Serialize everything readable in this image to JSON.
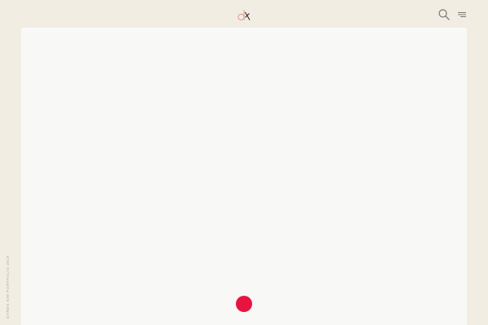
{
  "brand": {
    "logo_icon": "dk-monogram-icon",
    "logo_colors": {
      "d": "#d9a092",
      "k": "#2b2b2b"
    }
  },
  "header": {
    "search_icon": "search-icon",
    "menu_icon": "hamburger-menu-icon"
  },
  "sidebar": {
    "caption": "DAREN KIM PORTFOLIO 2019"
  },
  "loader": {
    "color": "#e8143f"
  },
  "colors": {
    "background": "#f2ede3",
    "stage": "#f8f8f7",
    "accent": "#e8143f",
    "icon": "#777777"
  }
}
